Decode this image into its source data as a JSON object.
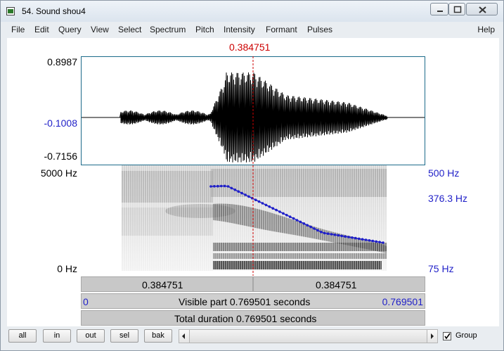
{
  "window": {
    "title": "54. Sound shou4"
  },
  "menu": [
    "File",
    "Edit",
    "Query",
    "View",
    "Select",
    "Spectrum",
    "Pitch",
    "Intensity",
    "Formant",
    "Pulses"
  ],
  "help": "Help",
  "cursor": {
    "time": "0.384751"
  },
  "waveform": {
    "max": "0.8987",
    "center": "-0.1008",
    "min": "-0.7156"
  },
  "spectrogram": {
    "top": "5000 Hz",
    "bottom": "0 Hz"
  },
  "pitch": {
    "top": "500 Hz",
    "current": "376.3 Hz",
    "bottom": "75 Hz"
  },
  "bars": {
    "left_time": "0.384751",
    "right_time": "0.384751",
    "visible_start": "0",
    "visible_label": "Visible part 0.769501 seconds",
    "visible_end": "0.769501",
    "total_label": "Total duration 0.769501 seconds"
  },
  "buttons": [
    "all",
    "in",
    "out",
    "sel",
    "bak"
  ],
  "group": {
    "label": "Group",
    "checked": true
  },
  "colors": {
    "cursor": "#cc0000",
    "pitch": "#1f1fc8",
    "frame": "#1c6b8a"
  }
}
